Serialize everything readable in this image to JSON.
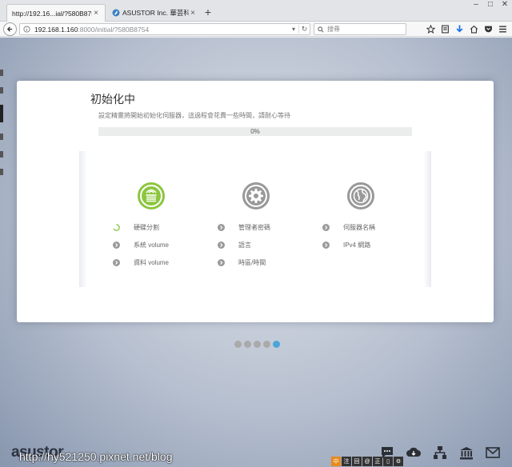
{
  "browser": {
    "tabs": [
      {
        "title": "http://192.16...ial/?580B8754",
        "close": "×"
      },
      {
        "title": "ASUSTOR Inc. 華芸科技 - ...",
        "close": "×"
      }
    ],
    "new_tab": "+",
    "address": {
      "host": "192.168.1.160",
      "rest": ":8000/initial/?580B8754"
    },
    "search_placeholder": "搜尋"
  },
  "dialog": {
    "title": "初始化中",
    "description": "設定精靈將開始初始化伺服器，這過程會花費一些時間，請耐心等待",
    "progress_text": "0%",
    "progress_value": 0,
    "columns": [
      {
        "icon": "storage-icon",
        "state": "active",
        "steps": [
          {
            "label": "硬碟分割",
            "state": "loading"
          },
          {
            "label": "系統 volume",
            "state": "pending"
          },
          {
            "label": "資料 volume",
            "state": "pending"
          }
        ]
      },
      {
        "icon": "gear-icon",
        "state": "pending",
        "steps": [
          {
            "label": "管理者密碼",
            "state": "pending"
          },
          {
            "label": "語言",
            "state": "pending"
          },
          {
            "label": "時區/時間",
            "state": "pending"
          }
        ]
      },
      {
        "icon": "globe-icon",
        "state": "pending",
        "steps": [
          {
            "label": "伺服器名稱",
            "state": "pending"
          },
          {
            "label": "IPv4 網路",
            "state": "pending"
          }
        ]
      }
    ],
    "page_dots": {
      "count": 5,
      "active": 5
    }
  },
  "bottom": {
    "brand": "asustor",
    "watermark": "http://hy521250.pixnet.net/blog",
    "ime": [
      "中",
      "注",
      "回",
      "@",
      "正",
      "▯",
      "⚙"
    ]
  },
  "colors": {
    "active_stage": "#8cc63f",
    "pending_stage": "#999999",
    "active_page_dot": "#4aa6d8",
    "page_dot": "#aaaaaa"
  }
}
